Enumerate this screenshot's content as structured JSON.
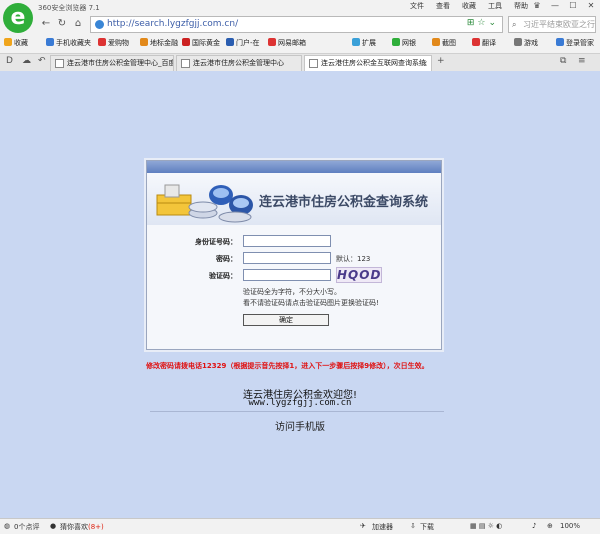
{
  "browser": {
    "window_title": "360安全浏览器 7.1",
    "menu": [
      "文件",
      "查看",
      "收藏",
      "工具",
      "帮助"
    ],
    "window_controls": [
      "♛",
      "—",
      "☐",
      "✕"
    ],
    "url": "http://search.lygzfgjj.com.cn/",
    "search_placeholder": "习近平结束欧亚之行",
    "favorites": [
      "收藏",
      "手机收藏夹",
      "爱购物",
      "地标金融",
      "国际黄金",
      "门户-在",
      "网易邮箱",
      "扩展",
      "网银",
      "截图",
      "翻译",
      "游戏",
      "登录管家"
    ],
    "tabs": [
      {
        "title": "连云港市住房公积金管理中心_百度搜",
        "active": false
      },
      {
        "title": "连云港市住房公积金管理中心",
        "active": false
      },
      {
        "title": "连云港住房公积金互联网查询系统",
        "active": true
      }
    ],
    "status": {
      "comments": "0个点评",
      "daily_recommend": "猜你喜欢",
      "daily_count": "(8+)",
      "accelerator": "加速器",
      "download": "下载",
      "zoom": "100%"
    }
  },
  "page": {
    "system_title": "连云港市住房公积金查询系统",
    "id_label": "身份证号码：",
    "password_label": "密码：",
    "password_hint": "默认：123",
    "captcha_label": "验证码：",
    "captcha_text": "HQOD",
    "captcha_hint_1": "验证码全为字符，不分大小写。",
    "captcha_hint_2": "看不请验证码请点击验证码图片更换验证码!",
    "submit_label": "确定",
    "notice": "修改密码请拨电话12329（根据提示音先按择1，进入下一步骤后按择9修改），次日生效。",
    "welcome_line": "连云港住房公积金欢迎您!",
    "website": "www.lygzfgjj.com.cn",
    "mobile_link": "访问手机版"
  },
  "colors": {
    "page_background": "#c9d7f2",
    "notice_red": "#e01010",
    "panel_header": "#5f7fc0"
  }
}
